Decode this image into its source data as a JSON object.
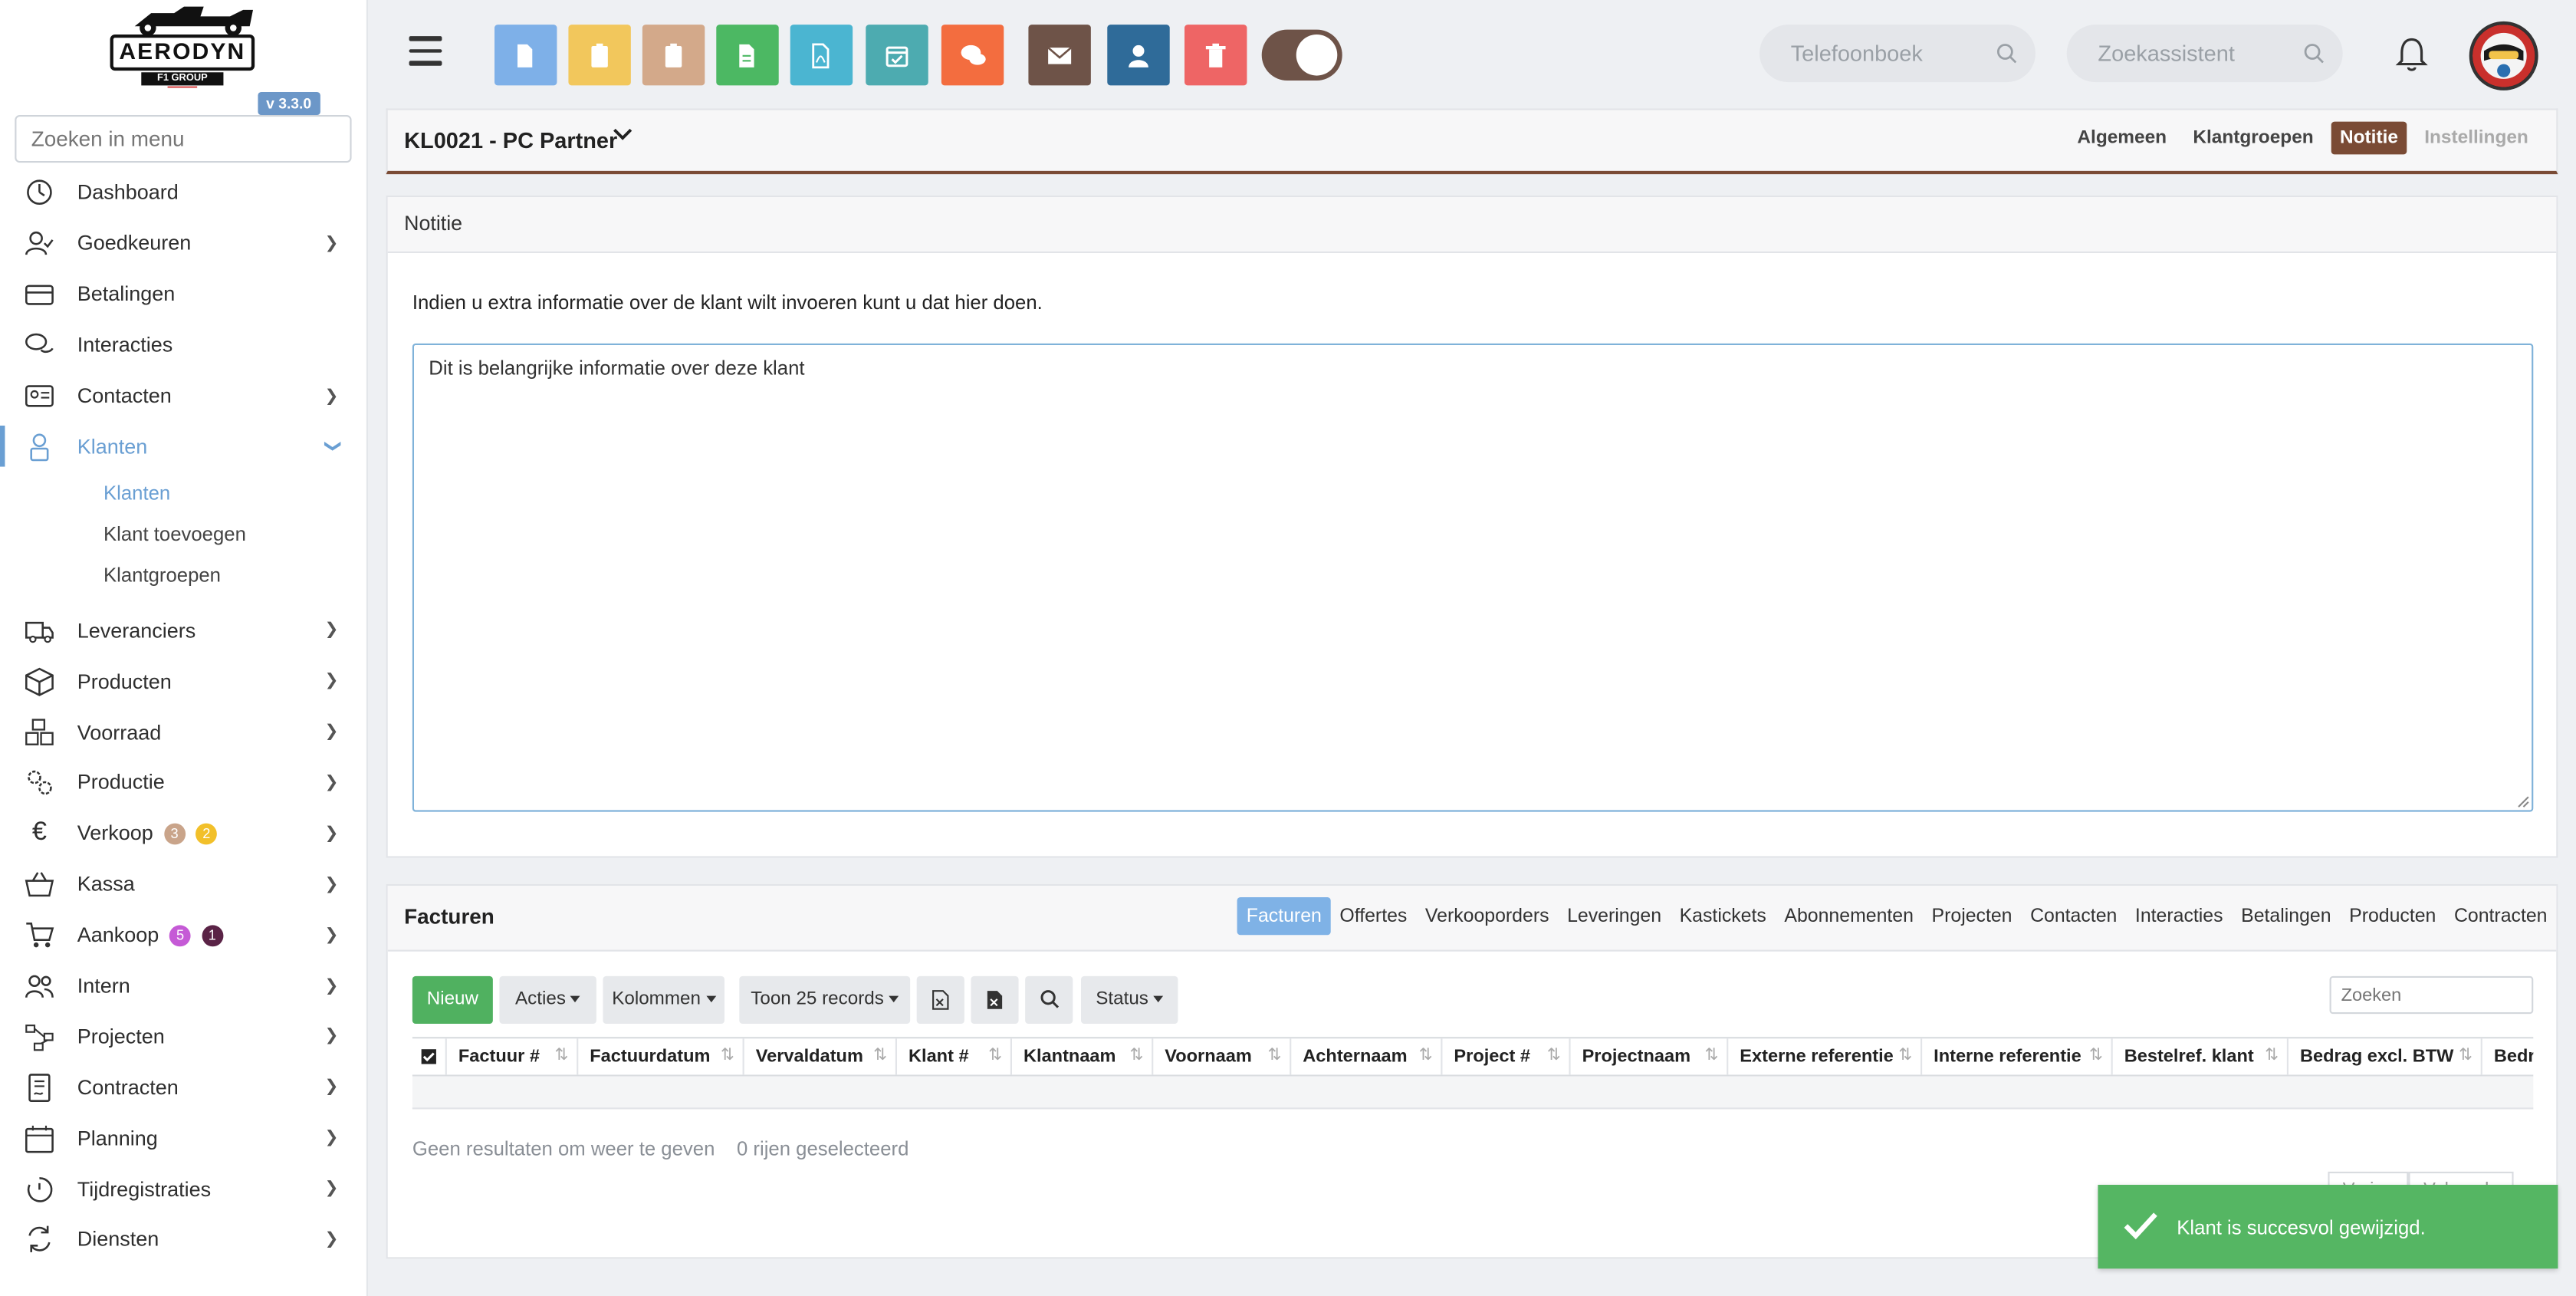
{
  "brand": {
    "name": "AERODYN",
    "subtitle": "F1 GROUP",
    "version": "v 3.3.0"
  },
  "sidebar": {
    "search_placeholder": "Zoeken in menu",
    "items": [
      {
        "label": "Dashboard",
        "icon": "dashboard-icon"
      },
      {
        "label": "Goedkeuren",
        "icon": "user-check-icon"
      },
      {
        "label": "Betalingen",
        "icon": "credit-card-icon"
      },
      {
        "label": "Interacties",
        "icon": "chat-icon"
      },
      {
        "label": "Contacten",
        "icon": "contact-card-icon"
      },
      {
        "label": "Klanten",
        "icon": "customer-icon"
      },
      {
        "label": "Leveranciers",
        "icon": "truck-icon"
      },
      {
        "label": "Producten",
        "icon": "box-icon"
      },
      {
        "label": "Voorraad",
        "icon": "boxes-icon"
      },
      {
        "label": "Productie",
        "icon": "gears-icon"
      },
      {
        "label": "Verkoop",
        "icon": "euro-icon",
        "badges": [
          "3",
          "2"
        ]
      },
      {
        "label": "Kassa",
        "icon": "basket-icon"
      },
      {
        "label": "Aankoop",
        "icon": "cart-icon",
        "badges": [
          "5",
          "1"
        ]
      },
      {
        "label": "Intern",
        "icon": "users-icon"
      },
      {
        "label": "Projecten",
        "icon": "project-icon"
      },
      {
        "label": "Contracten",
        "icon": "contract-icon"
      },
      {
        "label": "Planning",
        "icon": "calendar-icon"
      },
      {
        "label": "Tijdregistraties",
        "icon": "timer-icon"
      },
      {
        "label": "Diensten",
        "icon": "refresh-icon"
      }
    ],
    "klanten_sub": [
      "Klanten",
      "Klant toevoegen",
      "Klantgroepen"
    ]
  },
  "topbar": {
    "buttons": [
      {
        "name": "document-icon",
        "color": "#7eb0e8"
      },
      {
        "name": "clipboard-icon",
        "color": "#f2c75c"
      },
      {
        "name": "clipboard-icon",
        "color": "#d3a98a"
      },
      {
        "name": "sheet-icon",
        "color": "#4cb863"
      },
      {
        "name": "pdf-icon",
        "color": "#4bb5d1"
      },
      {
        "name": "calendar-check-icon",
        "color": "#4dabb0"
      },
      {
        "name": "comments-icon",
        "color": "#f36d3f"
      },
      {
        "name": "envelope-icon",
        "color": "#6e5348"
      },
      {
        "name": "user-icon",
        "color": "#2f6b99"
      },
      {
        "name": "trash-icon",
        "color": "#ee6565"
      }
    ],
    "phonebook_placeholder": "Telefoonboek",
    "assistant_placeholder": "Zoekassistent"
  },
  "header": {
    "title": "KL0021 - PC Partner",
    "tabs": [
      {
        "label": "Algemeen",
        "state": "normal"
      },
      {
        "label": "Klantgroepen",
        "state": "normal"
      },
      {
        "label": "Notitie",
        "state": "active"
      },
      {
        "label": "Instellingen",
        "state": "disabled"
      }
    ]
  },
  "note": {
    "title": "Notitie",
    "description": "Indien u extra informatie over de klant wilt invoeren kunt u dat hier doen.",
    "value": "Dit is belangrijke informatie over deze klant"
  },
  "invoices": {
    "title": "Facturen",
    "tabs": [
      "Facturen",
      "Offertes",
      "Verkooporders",
      "Leveringen",
      "Kastickets",
      "Abonnementen",
      "Projecten",
      "Contacten",
      "Interacties",
      "Betalingen",
      "Producten",
      "Contracten"
    ],
    "toolbar": {
      "new": "Nieuw",
      "actions": "Acties",
      "columns": "Kolommen",
      "records": "Toon 25 records",
      "status": "Status"
    },
    "search_placeholder": "Zoeken",
    "columns": [
      "Factuur #",
      "Factuurdatum",
      "Vervaldatum",
      "Klant #",
      "Klantnaam",
      "Voornaam",
      "Achternaam",
      "Project #",
      "Projectnaam",
      "Externe referentie",
      "Interne referentie",
      "Bestelref. klant",
      "Bedrag excl. BTW",
      "Bedr"
    ],
    "empty_text": "Geen resultaten om weer te geven",
    "selected_text": "0 rijen geselecteerd",
    "pager": [
      "Vorige",
      "Volgende"
    ]
  },
  "toast": {
    "message": "Klant is succesvol gewijzigd."
  }
}
